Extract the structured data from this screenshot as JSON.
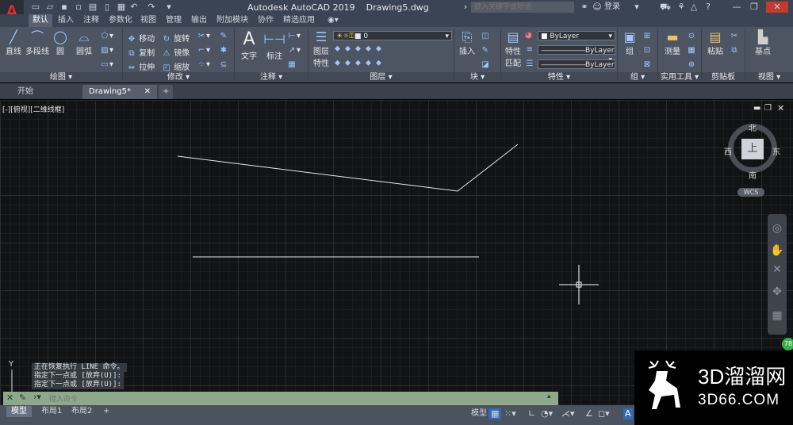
{
  "titlebar": {
    "app": "Autodesk AutoCAD 2019",
    "file": "Drawing5.dwg",
    "search_placeholder": "键入关键字或短语",
    "login": "登录"
  },
  "ribbon_tabs": [
    "默认",
    "插入",
    "注释",
    "参数化",
    "视图",
    "管理",
    "输出",
    "附加模块",
    "协作",
    "精选应用"
  ],
  "panels": {
    "draw": {
      "title": "绘图",
      "line": "直线",
      "polyline": "多段线",
      "circle": "圆",
      "arc": "圆弧"
    },
    "modify": {
      "title": "修改",
      "move": "移动",
      "rotate": "旋转",
      "copy": "复制",
      "mirror": "镜像",
      "stretch": "拉伸",
      "scale": "缩放"
    },
    "annotation": {
      "title": "注释",
      "text": "文字",
      "dimension": "标注"
    },
    "layers": {
      "title": "图层",
      "layer_props_1": "图层",
      "layer_props_2": "特性",
      "current_layer": "0"
    },
    "block": {
      "title": "块",
      "insert": "插入"
    },
    "properties": {
      "title": "特性",
      "match_1": "特性",
      "match_2": "匹配",
      "color": "ByLayer",
      "linetype": "ByLayer",
      "lineweight": "ByLayer"
    },
    "groups": {
      "title": "组",
      "group": "组"
    },
    "utilities": {
      "title": "实用工具",
      "measure": "测量"
    },
    "clipboard": {
      "title": "剪贴板",
      "paste": "粘贴"
    },
    "view": {
      "title": "视图",
      "base": "基点"
    }
  },
  "doc_tabs": {
    "start": "开始",
    "drawing": "Drawing5*"
  },
  "viewport": {
    "label": "[-][俯视][二维线框]"
  },
  "viewcube": {
    "north": "北",
    "south": "南",
    "east": "东",
    "west": "西",
    "top": "上",
    "wcs": "WCS"
  },
  "command": {
    "history": [
      "正在恢复执行 LINE 命令。",
      "指定下一点或 [放弃(U)]:",
      "指定下一点或 [放弃(U)]:"
    ],
    "placeholder": "键入命令"
  },
  "layout_tabs": [
    "模型",
    "布局1",
    "布局2"
  ],
  "status": {
    "model": "模型",
    "badge": "78"
  },
  "watermark": {
    "brand": "3D溜溜网",
    "domain": "3D66.COM"
  }
}
